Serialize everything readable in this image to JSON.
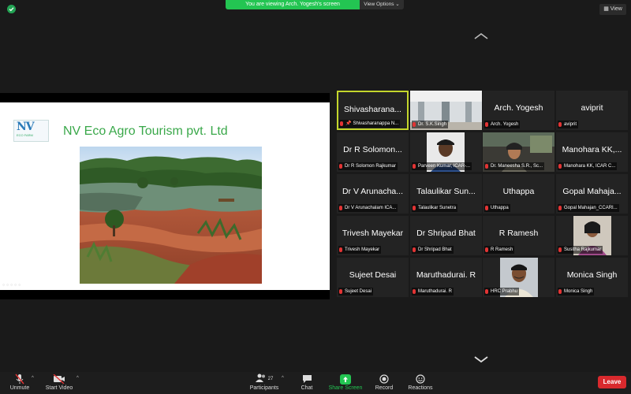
{
  "top_bar": {
    "viewing_banner": "You are viewing Arch. Yogesh's screen",
    "view_options": "View Options",
    "view_button": "View"
  },
  "shared_slide": {
    "logo_text": "NV",
    "logo_subtext": "ECO FARM",
    "title": "NV Eco Agro Tourism pvt. Ltd"
  },
  "gallery": [
    {
      "big": "Shivasharana...",
      "label": "Shivasharanappa N...",
      "active": true,
      "pinned": true
    },
    {
      "big": "",
      "label": "Dr. S.K.Singh"
    },
    {
      "big": "Arch. Yogesh",
      "label": "Arch. Yogesh"
    },
    {
      "big": "aviprit",
      "label": "aviprit"
    },
    {
      "big": "Dr R Solomon...",
      "label": "Dr R Solomon Rajkumar"
    },
    {
      "big": "",
      "label": "Parveen Kumar, ICAR-..."
    },
    {
      "big": "",
      "label": "Dr. Maneesha S.R., Sc..."
    },
    {
      "big": "Manohara KK,...",
      "label": "Manohara KK, ICAR C..."
    },
    {
      "big": "Dr V Arunacha...",
      "label": "Dr V Arunachalam ICA..."
    },
    {
      "big": "Talaulikar Sun...",
      "label": "Talaulikar Sunetra"
    },
    {
      "big": "Uthappa",
      "label": "Uthappa"
    },
    {
      "big": "Gopal Mahaja...",
      "label": "Gopal Mahajan_CCARI..."
    },
    {
      "big": "Trivesh Mayekar",
      "label": "Trivesh Mayekar"
    },
    {
      "big": "Dr Shripad Bhat",
      "label": "Dr Shripad Bhat"
    },
    {
      "big": "R Ramesh",
      "label": "R Ramesh"
    },
    {
      "big": "",
      "label": "Susitha Rajkumar"
    },
    {
      "big": "Sujeet Desai",
      "label": "Sujeet Desai"
    },
    {
      "big": "Maruthadurai. R",
      "label": "Maruthadurai. R"
    },
    {
      "big": "",
      "label": "HRC Prabhu"
    },
    {
      "big": "Monica Singh",
      "label": "Monica Singh"
    }
  ],
  "toolbar": {
    "unmute": "Unmute",
    "start_video": "Start Video",
    "participants": "Participants",
    "participant_count": "27",
    "chat": "Chat",
    "share_screen": "Share Screen",
    "record": "Record",
    "reactions": "Reactions",
    "leave": "Leave"
  },
  "colors": {
    "banner_green": "#23c552",
    "active_speaker": "#c4d62c",
    "leave_red": "#d8292d",
    "muted_red": "#e23434"
  }
}
